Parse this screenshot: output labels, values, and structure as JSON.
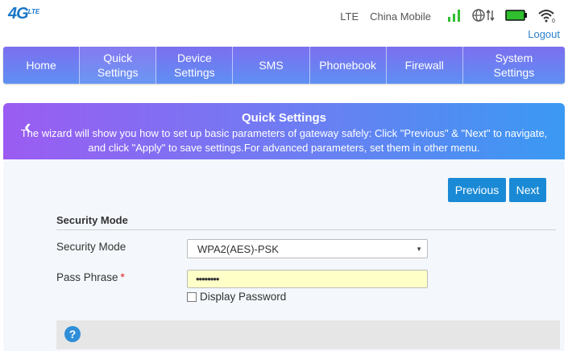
{
  "logo": {
    "main": "4G",
    "sub": "LTE"
  },
  "status": {
    "network_type": "LTE",
    "carrier": "China Mobile",
    "signal_color": "#2fbf2f",
    "battery_color": "#2fbf2f"
  },
  "logout_label": "Logout",
  "nav": {
    "items": [
      {
        "label": "Home"
      },
      {
        "label": "Quick Settings"
      },
      {
        "label": "Device Settings"
      },
      {
        "label": "SMS"
      },
      {
        "label": "Phonebook"
      },
      {
        "label": "Firewall"
      },
      {
        "label": "System Settings"
      }
    ]
  },
  "banner": {
    "title": "Quick Settings",
    "description": "The wizard will show you how to set up basic parameters of gateway safely: Click \"Previous\" & \"Next\" to navigate, and click \"Apply\" to save settings.For advanced parameters, set them in other menu."
  },
  "buttons": {
    "previous": "Previous",
    "next": "Next"
  },
  "form": {
    "section_title": "Security Mode",
    "security_mode_label": "Security Mode",
    "security_mode_value": "WPA2(AES)-PSK",
    "pass_phrase_label": "Pass Phrase",
    "required_mark": "*",
    "pass_phrase_value": "••••••••",
    "display_password_label": "Display Password"
  },
  "help": {
    "icon": "?"
  }
}
